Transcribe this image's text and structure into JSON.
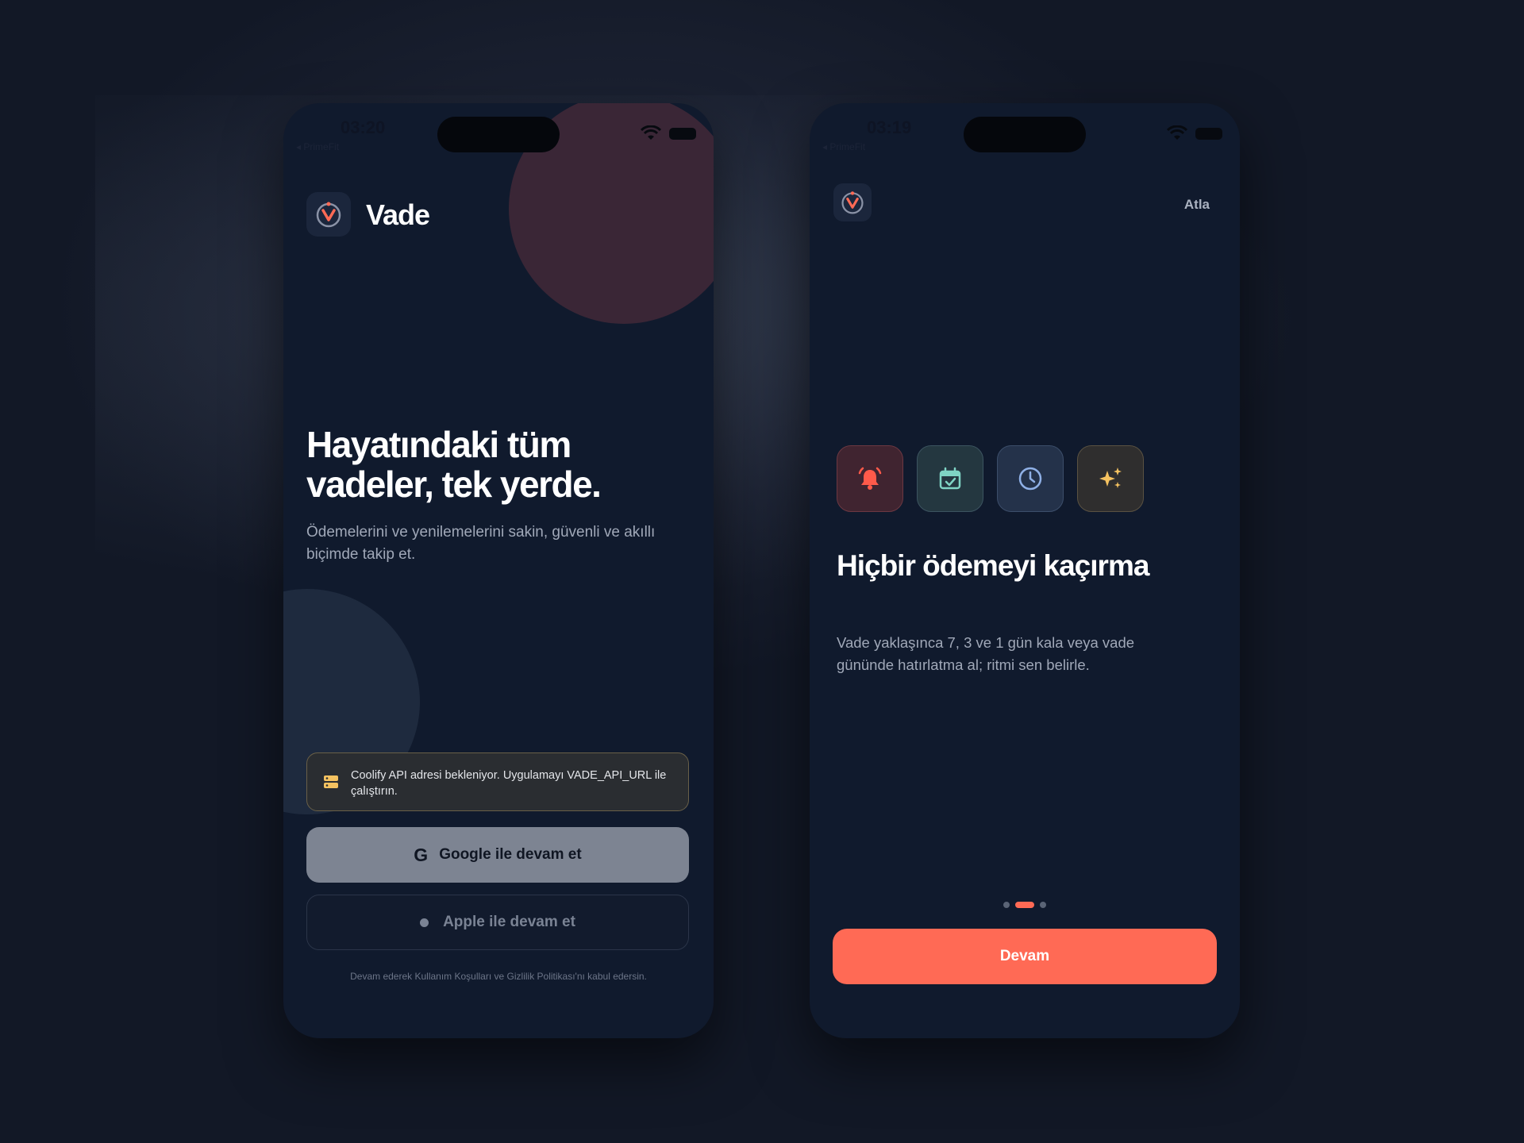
{
  "screens": [
    {
      "status": {
        "time": "03:20",
        "carrier": "◂ PrimeFit"
      },
      "brand": "Vade",
      "hero_title": "Hayatındaki tüm vadeler, tek yerde.",
      "hero_subtitle": "Ödemelerini ve yenilemelerini sakin, güvenli ve akıllı biçimde takip et.",
      "notice": "Coolify API adresi bekleniyor. Uygulamayı VADE_API_URL ile çalıştırın.",
      "google_button": "Google ile devam et",
      "google_icon_letter": "G",
      "apple_button": "Apple ile devam et",
      "terms": "Devam ederek Kullanım Koşulları ve Gizlilik Politikası'nı kabul edersin."
    },
    {
      "status": {
        "time": "03:19",
        "carrier": "◂ PrimeFit"
      },
      "skip": "Atla",
      "feature_icons": [
        "bell-icon",
        "calendar-check-icon",
        "clock-icon",
        "sparkles-icon"
      ],
      "title": "Hiçbir ödemeyi kaçırma",
      "subtitle": "Vade yaklaşınca 7, 3 ve 1 gün kala veya vade gününde hatırlatma al; ritmi sen belirle.",
      "pagination": {
        "current": 2,
        "total": 3
      },
      "continue_button": "Devam"
    }
  ],
  "colors": {
    "accent": "#ff6a55",
    "background": "#101a2d",
    "notice_border": "#6a6048",
    "amber": "#f5c260",
    "teal": "#7fd4c4",
    "blue": "#8fb0e6"
  }
}
